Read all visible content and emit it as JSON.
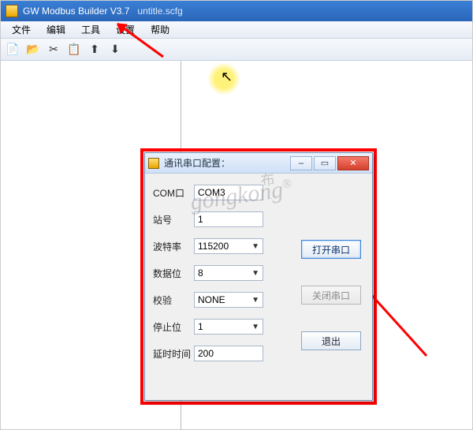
{
  "app": {
    "title": "GW Modbus Builder V3.7",
    "document": "untitle.scfg"
  },
  "menu": {
    "file": "文件",
    "edit": "编辑",
    "tools": "工具",
    "settings": "设置",
    "help": "帮助"
  },
  "toolbar_icons": {
    "new": "📄",
    "open": "📂",
    "cut": "✂",
    "copy": "📋",
    "upload": "⬆",
    "download": "⬇"
  },
  "dialog": {
    "title": "通讯串口配置：",
    "labels": {
      "com": "COM口",
      "station": "站号",
      "baud": "波特率",
      "databits": "数据位",
      "parity": "校验",
      "stopbits": "停止位",
      "delay": "延时时间"
    },
    "values": {
      "com": "COM3",
      "station": "1",
      "baud": "115200",
      "databits": "8",
      "parity": "NONE",
      "stopbits": "1",
      "delay": "200"
    },
    "buttons": {
      "open_port": "打开串口",
      "close_port": "关闭串口",
      "exit": "退出"
    },
    "window_controls": {
      "minimize": "–",
      "maximize": "▭",
      "close": "✕"
    }
  },
  "watermark": {
    "en": "gongkong",
    "reg": "®",
    "cn": "布"
  }
}
